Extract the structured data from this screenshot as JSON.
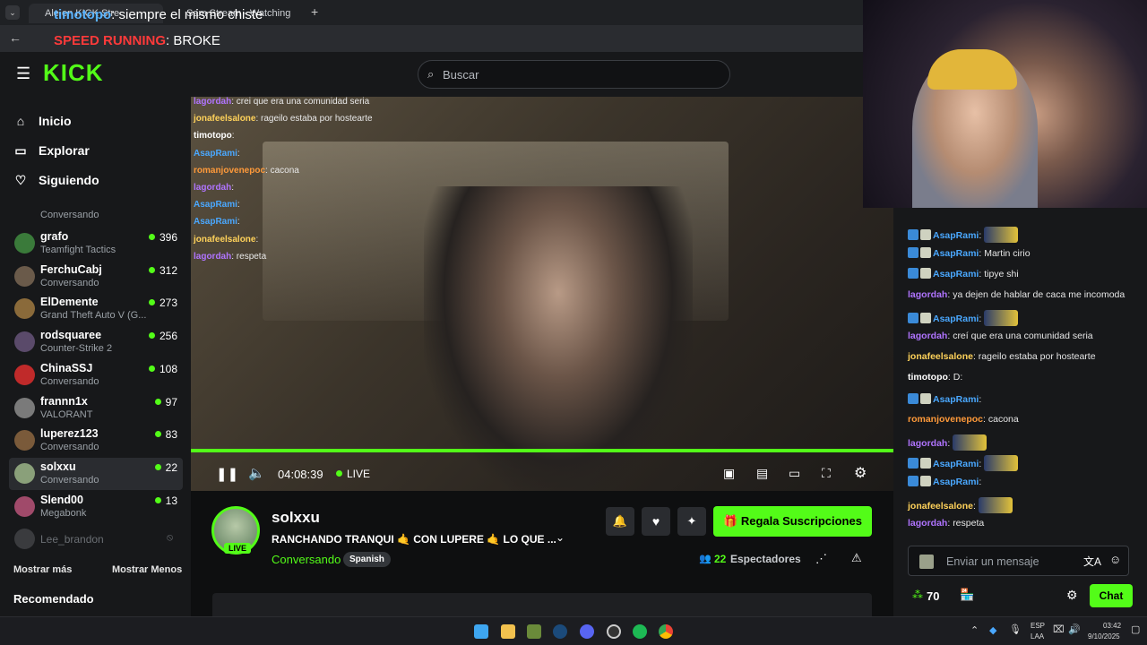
{
  "browser": {
    "tabs": [
      "Ale en KICK Stre",
      "Sam Stream - Watching"
    ],
    "overlay_line1_user": "timotopo",
    "overlay_line1_text": "siempre el mismo chiste",
    "overlay_line2_user": "SPEED RUNNING",
    "overlay_line2_text": "BROKE"
  },
  "header": {
    "logo": "KICK",
    "search_placeholder": "Buscar"
  },
  "sidebar": {
    "nav": [
      {
        "label": "Inicio",
        "icon": "home-icon"
      },
      {
        "label": "Explorar",
        "icon": "browse-icon"
      },
      {
        "label": "Siguiendo",
        "icon": "heart-icon"
      }
    ],
    "channels": [
      {
        "name": "grafo",
        "sub": "Teamfight Tactics",
        "count": "396",
        "color": "#3a7a3a"
      },
      {
        "name": "FerchuCabj",
        "sub": "Conversando",
        "count": "312",
        "color": "#6a5a4a"
      },
      {
        "name": "ElDemente",
        "sub": "Grand Theft Auto V (G...",
        "count": "273",
        "color": "#8a6a3a"
      },
      {
        "name": "rodsquaree",
        "sub": "Counter-Strike 2",
        "count": "256",
        "color": "#5a4a6a"
      },
      {
        "name": "ChinaSSJ",
        "sub": "Conversando",
        "count": "108",
        "color": "#c02a2a"
      },
      {
        "name": "frannn1x",
        "sub": "VALORANT",
        "count": "97",
        "color": "#7a7a7a"
      },
      {
        "name": "luperez123",
        "sub": "Conversando",
        "count": "83",
        "color": "#7a5a3a"
      },
      {
        "name": "solxxu",
        "sub": "Conversando",
        "count": "22",
        "color": "#8aa07a"
      },
      {
        "name": "Slend00",
        "sub": "Megabonk",
        "count": "13",
        "color": "#a04a6a"
      }
    ],
    "first_sub": "Conversando",
    "offline": "Lee_brandon",
    "show_more": "Mostrar más",
    "show_less": "Mostrar Menos",
    "recommended": "Recomendado"
  },
  "stream_overlay_chat": [
    {
      "user": "lagordah",
      "text": "crei que era una comunidad seria",
      "color": "#b074ff"
    },
    {
      "user": "jonafeelsalone",
      "text": "rageilo estaba por hostearte",
      "color": "#ffd25a"
    },
    {
      "user": "timotopo",
      "text": "",
      "color": "#ffffff"
    },
    {
      "user": "AsapRami",
      "text": "",
      "color": "#4aa8ff"
    },
    {
      "user": "romanjovenepoc",
      "text": "cacona",
      "color": "#ff9a3a"
    },
    {
      "user": "lagordah",
      "text": "",
      "color": "#b074ff"
    },
    {
      "user": "AsapRami",
      "text": "",
      "color": "#4aa8ff"
    },
    {
      "user": "AsapRami",
      "text": "",
      "color": "#4aa8ff"
    },
    {
      "user": "jonafeelsalone",
      "text": "",
      "color": "#ffd25a"
    },
    {
      "user": "lagordah",
      "text": "respeta",
      "color": "#b074ff"
    }
  ],
  "player": {
    "time": "04:08:39",
    "live": "LIVE",
    "progress": 1.0
  },
  "stream": {
    "channel": "solxxu",
    "title": "RANCHANDO TRANQUI 🤙 CON LUPERE 🤙 LO QUE ...",
    "category": "Conversando",
    "tag": "Spanish",
    "live_badge": "LIVE",
    "viewers": "22",
    "viewers_label": "Espectadores",
    "gift_button": "Regala Suscripciones"
  },
  "chat": {
    "messages": [
      {
        "user": "AsapRami",
        "text": "",
        "color": "#4aa8ff",
        "emote": true,
        "badges": true
      },
      {
        "user": "AsapRami",
        "text": "Martin cirio",
        "color": "#4aa8ff",
        "emote": false,
        "badges": true
      },
      {
        "user": "AsapRami",
        "text": "tipye shi",
        "color": "#4aa8ff",
        "emote": false,
        "badges": true
      },
      {
        "user": "lagordah",
        "text": "ya dejen de hablar de caca me incomoda",
        "color": "#b074ff",
        "emote": false,
        "badges": false
      },
      {
        "user": "AsapRami",
        "text": "",
        "color": "#4aa8ff",
        "emote": true,
        "badges": true
      },
      {
        "user": "lagordah",
        "text": "creí que era una comunidad seria",
        "color": "#b074ff",
        "emote": false,
        "badges": false
      },
      {
        "user": "jonafeelsalone",
        "text": "rageilo estaba por hostearte",
        "color": "#ffd25a",
        "emote": false,
        "badges": false
      },
      {
        "user": "timotopo",
        "text": "D:",
        "color": "#ffffff",
        "emote": false,
        "badges": false
      },
      {
        "user": "AsapRami",
        "text": "",
        "color": "#4aa8ff",
        "emote": false,
        "badges": true
      },
      {
        "user": "romanjovenepoc",
        "text": "cacona",
        "color": "#ff9a3a",
        "emote": false,
        "badges": false
      },
      {
        "user": "lagordah",
        "text": "",
        "color": "#b074ff",
        "emote": true,
        "badges": false
      },
      {
        "user": "AsapRami",
        "text": "",
        "color": "#4aa8ff",
        "emote": true,
        "badges": true
      },
      {
        "user": "AsapRami",
        "text": "",
        "color": "#4aa8ff",
        "emote": false,
        "badges": true
      },
      {
        "user": "jonafeelsalone",
        "text": "",
        "color": "#ffd25a",
        "emote": true,
        "badges": false
      },
      {
        "user": "lagordah",
        "text": "respeta",
        "color": "#b074ff",
        "emote": false,
        "badges": false
      }
    ],
    "input_placeholder": "Enviar un mensaje",
    "points": "70",
    "send": "Chat"
  },
  "taskbar": {
    "lang1": "ESP",
    "lang2": "LAA",
    "time": "03:42",
    "date": "9/10/2025"
  },
  "colors": {
    "accent": "#53fc18"
  }
}
